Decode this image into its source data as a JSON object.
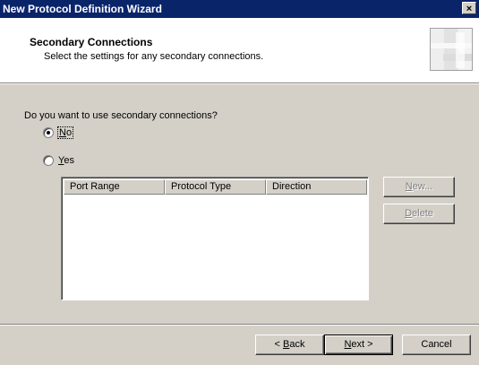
{
  "window": {
    "title": "New Protocol Definition Wizard",
    "close_label": "×"
  },
  "header": {
    "title": "Secondary Connections",
    "subtitle": "Select the settings for any secondary connections."
  },
  "main": {
    "question": "Do you want to use secondary connections?",
    "radio_no": {
      "mnemonic": "N",
      "rest": "o",
      "checked": true
    },
    "radio_yes": {
      "mnemonic": "Y",
      "rest": "es",
      "checked": false
    }
  },
  "listview": {
    "columns": [
      "Port Range",
      "Protocol Type",
      "Direction"
    ],
    "rows": []
  },
  "side_buttons": {
    "new": {
      "mnemonic": "N",
      "rest": "ew..."
    },
    "delete": {
      "mnemonic": "D",
      "rest": "elete"
    }
  },
  "footer": {
    "back": {
      "prefix": "< ",
      "mnemonic": "B",
      "rest": "ack"
    },
    "next": {
      "mnemonic": "N",
      "rest": "ext >"
    },
    "cancel": "Cancel"
  }
}
